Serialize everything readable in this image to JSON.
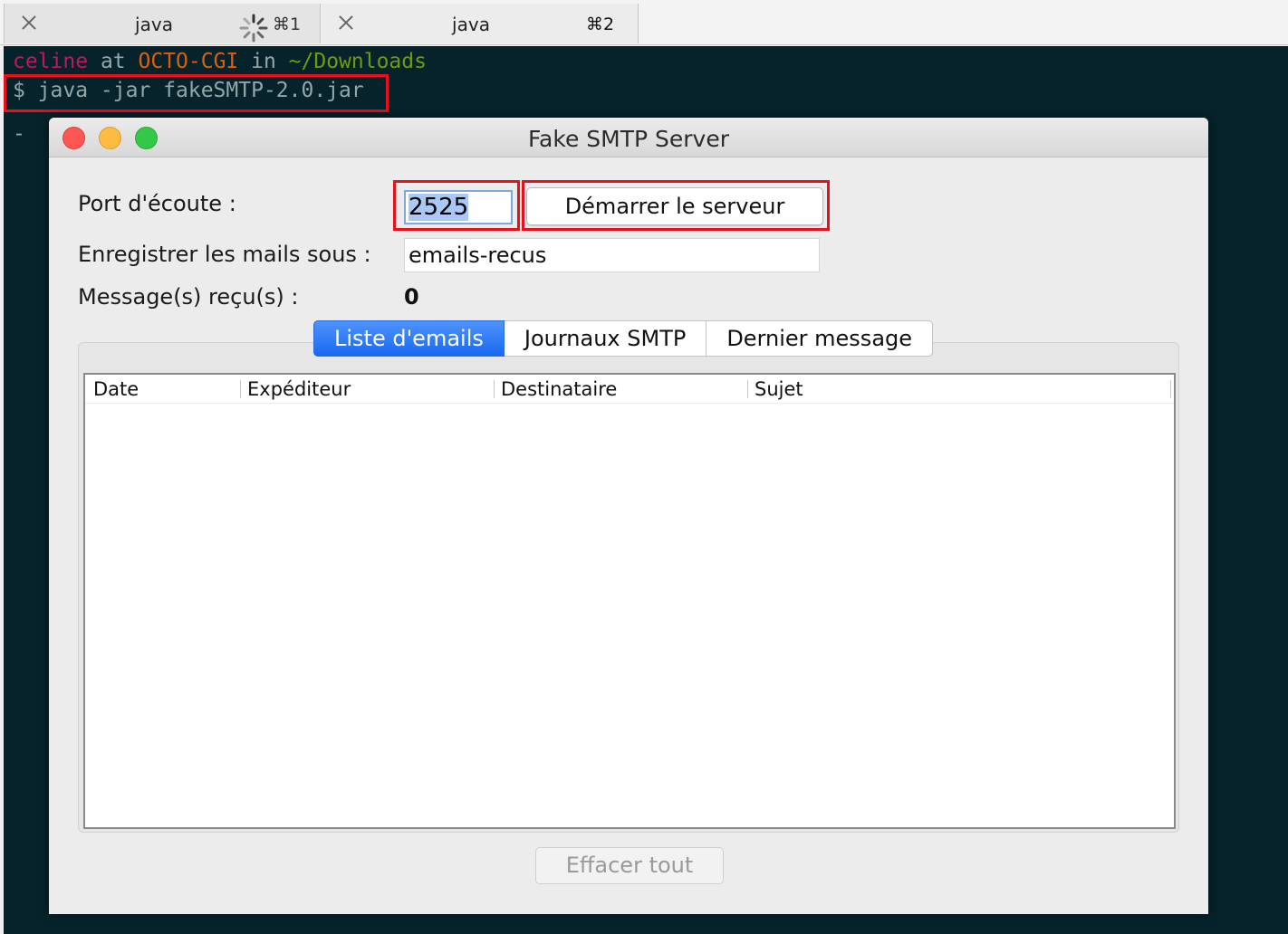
{
  "terminal_tabs": [
    {
      "title": "java",
      "shortcut": "⌘1",
      "busy": true
    },
    {
      "title": "java",
      "shortcut": "⌘2",
      "busy": false
    }
  ],
  "terminal": {
    "prompt": {
      "user": "celine",
      "at": " at ",
      "host": "OCTO-CGI",
      "in": " in ",
      "dir": "~/Downloads"
    },
    "command": "$ java -jar fakeSMTP-2.0.jar",
    "cursor": "-"
  },
  "window": {
    "title": "Fake SMTP Server",
    "port_label": "Port d'écoute :",
    "port_value": "2525",
    "start_button": "Démarrer le serveur",
    "save_label": "Enregistrer les mails sous :",
    "save_value": "emails-recus",
    "count_label": "Message(s) reçu(s) :",
    "count_value": "0",
    "tabs": [
      "Liste d'emails",
      "Journaux SMTP",
      "Dernier message"
    ],
    "active_tab": "Liste d'emails",
    "table_columns": [
      "Date",
      "Expéditeur",
      "Destinataire",
      "Sujet"
    ],
    "clear_button": "Effacer tout"
  },
  "colors": {
    "highlight": "#e8101a",
    "terminal_bg": "#06232b",
    "active_tab": "#1968f0"
  }
}
